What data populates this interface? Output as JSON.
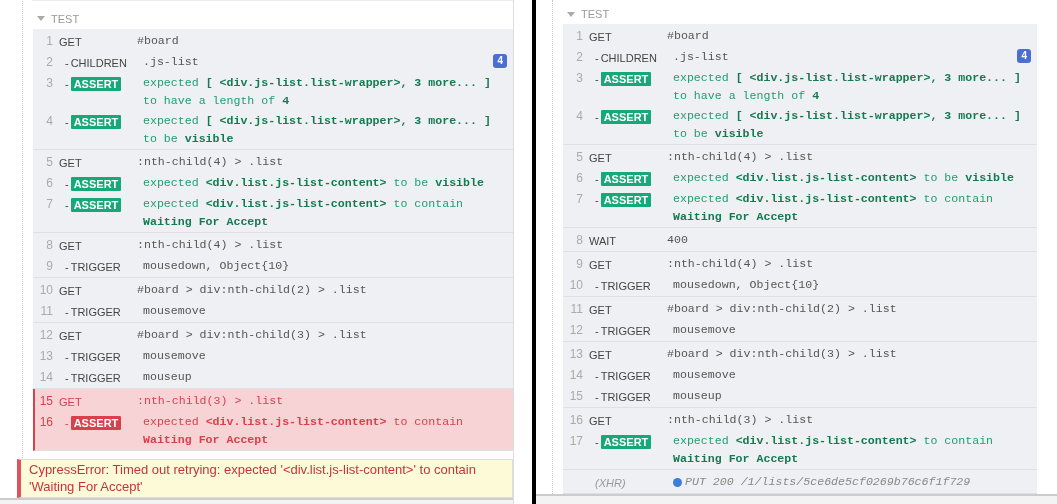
{
  "panels": [
    {
      "title": "TEST",
      "groups": [
        {
          "failed": false,
          "rows": [
            {
              "num": "1",
              "kind": "command",
              "name": "GET",
              "message": "#board"
            },
            {
              "num": "2",
              "kind": "child",
              "dash": "-",
              "name": "CHILDREN",
              "message": ".js-list",
              "count": "4"
            },
            {
              "num": "3",
              "kind": "assert",
              "dash": "-",
              "name": "ASSERT",
              "message": "expected **[ <div.js-list.list-wrapper>, 3 more... ]** to have a length of **4**"
            },
            {
              "num": "4",
              "kind": "assert",
              "dash": "-",
              "name": "ASSERT",
              "message": "expected **[ <div.js-list.list-wrapper>, 3 more... ]** to be **visible**"
            }
          ]
        },
        {
          "failed": false,
          "rows": [
            {
              "num": "5",
              "kind": "command",
              "name": "GET",
              "message": ":nth-child(4) > .list"
            },
            {
              "num": "6",
              "kind": "assert",
              "dash": "-",
              "name": "ASSERT",
              "message": "expected **<div.list.js-list-content>** to be **visible**"
            },
            {
              "num": "7",
              "kind": "assert",
              "dash": "-",
              "name": "ASSERT",
              "message": "expected **<div.list.js-list-content>** to contain **Waiting For Accept**"
            }
          ]
        },
        {
          "failed": false,
          "rows": [
            {
              "num": "8",
              "kind": "command",
              "name": "GET",
              "message": ":nth-child(4) > .list"
            },
            {
              "num": "9",
              "kind": "child",
              "dash": "-",
              "name": "TRIGGER",
              "message": "mousedown, Object{10}"
            }
          ]
        },
        {
          "failed": false,
          "rows": [
            {
              "num": "10",
              "kind": "command",
              "name": "GET",
              "message": "#board > div:nth-child(2) > .list"
            },
            {
              "num": "11",
              "kind": "child",
              "dash": "-",
              "name": "TRIGGER",
              "message": "mousemove"
            }
          ]
        },
        {
          "failed": false,
          "rows": [
            {
              "num": "12",
              "kind": "command",
              "name": "GET",
              "message": "#board > div:nth-child(3) > .list"
            },
            {
              "num": "13",
              "kind": "child",
              "dash": "-",
              "name": "TRIGGER",
              "message": "mousemove"
            },
            {
              "num": "14",
              "kind": "child",
              "dash": "-",
              "name": "TRIGGER",
              "message": "mouseup"
            }
          ]
        },
        {
          "failed": true,
          "rows": [
            {
              "num": "15",
              "kind": "command",
              "name": "GET",
              "message": ":nth-child(3) > .list"
            },
            {
              "num": "16",
              "kind": "assert",
              "dash": "-",
              "name": "ASSERT",
              "message": "expected **<div.list.js-list-content>** to contain **Waiting For Accept**"
            }
          ]
        }
      ],
      "error": "CypressError: Timed out retrying: expected '<div.list.js-list-content>' to contain 'Waiting For Accept'"
    },
    {
      "title": "TEST",
      "groups": [
        {
          "failed": false,
          "rows": [
            {
              "num": "1",
              "kind": "command",
              "name": "GET",
              "message": "#board"
            },
            {
              "num": "2",
              "kind": "child",
              "dash": "-",
              "name": "CHILDREN",
              "message": ".js-list",
              "count": "4"
            },
            {
              "num": "3",
              "kind": "assert",
              "dash": "-",
              "name": "ASSERT",
              "message": "expected **[ <div.js-list.list-wrapper>, 3 more... ]** to have a length of **4**"
            },
            {
              "num": "4",
              "kind": "assert",
              "dash": "-",
              "name": "ASSERT",
              "message": "expected **[ <div.js-list.list-wrapper>, 3 more... ]** to be **visible**"
            }
          ]
        },
        {
          "failed": false,
          "rows": [
            {
              "num": "5",
              "kind": "command",
              "name": "GET",
              "message": ":nth-child(4) > .list"
            },
            {
              "num": "6",
              "kind": "assert",
              "dash": "-",
              "name": "ASSERT",
              "message": "expected **<div.list.js-list-content>** to be **visible**"
            },
            {
              "num": "7",
              "kind": "assert",
              "dash": "-",
              "name": "ASSERT",
              "message": "expected **<div.list.js-list-content>** to contain **Waiting For Accept**"
            }
          ]
        },
        {
          "failed": false,
          "rows": [
            {
              "num": "8",
              "kind": "command",
              "name": "WAIT",
              "message": "400"
            }
          ]
        },
        {
          "failed": false,
          "rows": [
            {
              "num": "9",
              "kind": "command",
              "name": "GET",
              "message": ":nth-child(4) > .list"
            },
            {
              "num": "10",
              "kind": "child",
              "dash": "-",
              "name": "TRIGGER",
              "message": "mousedown, Object{10}"
            }
          ]
        },
        {
          "failed": false,
          "rows": [
            {
              "num": "11",
              "kind": "command",
              "name": "GET",
              "message": "#board > div:nth-child(2) > .list"
            },
            {
              "num": "12",
              "kind": "child",
              "dash": "-",
              "name": "TRIGGER",
              "message": "mousemove"
            }
          ]
        },
        {
          "failed": false,
          "rows": [
            {
              "num": "13",
              "kind": "command",
              "name": "GET",
              "message": "#board > div:nth-child(3) > .list"
            },
            {
              "num": "14",
              "kind": "child",
              "dash": "-",
              "name": "TRIGGER",
              "message": "mousemove"
            },
            {
              "num": "15",
              "kind": "child",
              "dash": "-",
              "name": "TRIGGER",
              "message": "mouseup"
            }
          ]
        },
        {
          "failed": false,
          "rows": [
            {
              "num": "16",
              "kind": "command",
              "name": "GET",
              "message": ":nth-child(3) > .list"
            },
            {
              "num": "17",
              "kind": "assert",
              "dash": "-",
              "name": "ASSERT",
              "message": "expected **<div.list.js-list-content>** to contain **Waiting For Accept**"
            }
          ]
        },
        {
          "failed": false,
          "rows": [
            {
              "kind": "xhr",
              "name": "(XHR)",
              "message": "PUT 200 /1/lists/5ce6de5cf0269b76c6f1f729"
            }
          ]
        }
      ]
    }
  ]
}
